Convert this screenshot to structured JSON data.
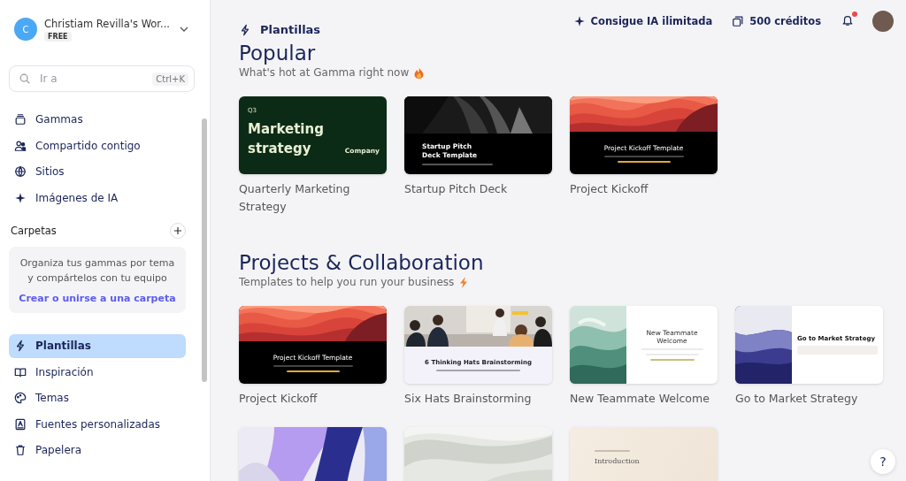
{
  "workspace": {
    "initial": "C",
    "name": "Christiam Revilla's Wor...",
    "plan": "FREE"
  },
  "search": {
    "placeholder": "Ir a",
    "shortcut": "Ctrl+K"
  },
  "nav_top": [
    {
      "label": "Gammas",
      "selected": false
    },
    {
      "label": "Compartido contigo",
      "selected": false
    },
    {
      "label": "Sitios",
      "selected": false
    },
    {
      "label": "Imágenes de IA",
      "selected": false
    }
  ],
  "folders": {
    "title": "Carpetas",
    "hint": "Organiza tus gammas por tema y compártelos con tu equipo",
    "link": "Crear o unirse a una carpeta"
  },
  "nav_bottom": [
    {
      "label": "Plantillas",
      "selected": true
    },
    {
      "label": "Inspiración",
      "selected": false
    },
    {
      "label": "Temas",
      "selected": false
    },
    {
      "label": "Fuentes personalizadas",
      "selected": false
    },
    {
      "label": "Papelera",
      "selected": false
    }
  ],
  "header": {
    "title": "Plantillas",
    "upgrade": "Consigue IA ilimitada",
    "credits": "500 créditos",
    "has_notification": true
  },
  "sections": [
    {
      "title": "Popular",
      "subtitle": "What's hot at Gamma right now",
      "cards": [
        {
          "label": "Quarterly Marketing Strategy",
          "thumb": {
            "kind": "green",
            "eyebrow": "Q3",
            "title": "Marketing strategy",
            "corner": "Company"
          }
        },
        {
          "label": "Startup Pitch Deck",
          "thumb": {
            "kind": "dark",
            "title": "Startup Pitch Deck Template"
          }
        },
        {
          "label": "Project Kickoff",
          "thumb": {
            "kind": "wave",
            "title": "Project Kickoff Template"
          }
        }
      ]
    },
    {
      "title": "Projects & Collaboration",
      "subtitle": "Templates to help you run your business",
      "cards": [
        {
          "label": "Project Kickoff",
          "thumb": {
            "kind": "wave",
            "title": "Project Kickoff Template"
          }
        },
        {
          "label": "Six Hats Brainstorming",
          "thumb": {
            "title": "6 Thinking Hats Brainstorming"
          }
        },
        {
          "label": "New Teammate Welcome",
          "thumb": {
            "kind": "teal",
            "title": "New Teammate Welcome"
          }
        },
        {
          "label": "Go to Market Strategy",
          "thumb": {
            "kind": "navy",
            "title": "Go to Market Strategy"
          }
        },
        {
          "thumb": {
            "kind": "purple"
          }
        },
        {
          "thumb": {
            "kind": "silver"
          }
        },
        {
          "thumb": {
            "kind": "cream",
            "title": "Introduction"
          }
        }
      ]
    }
  ],
  "help": "?"
}
